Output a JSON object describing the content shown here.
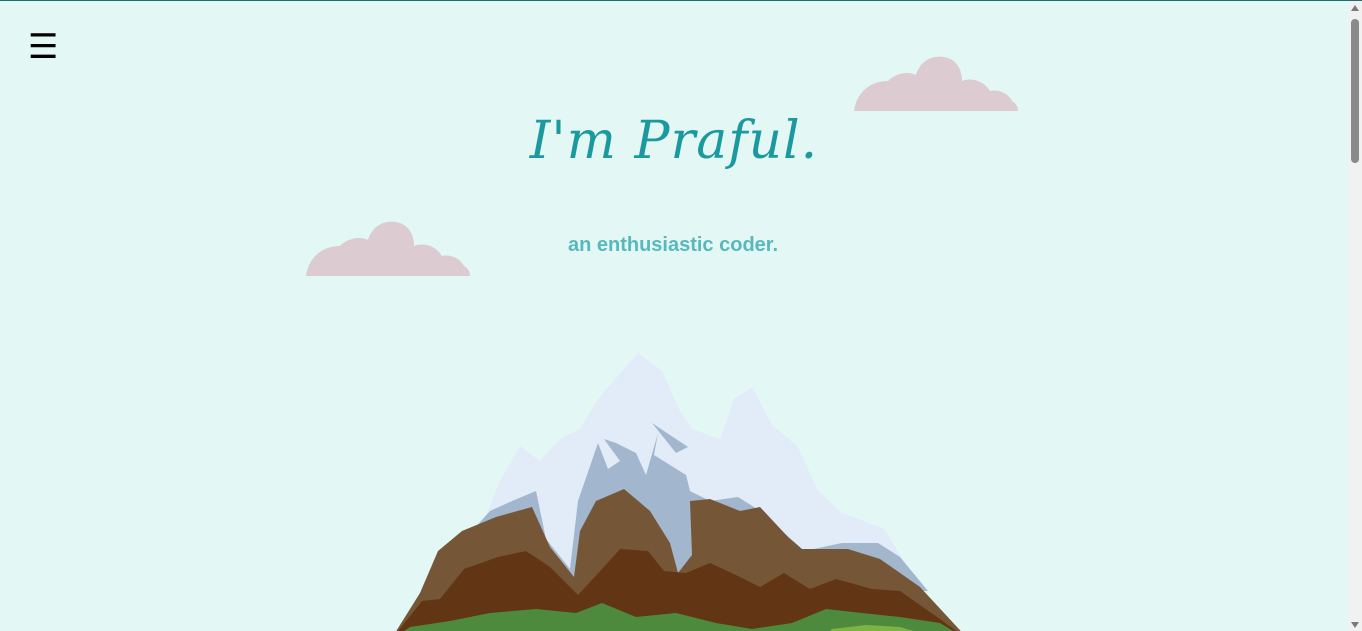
{
  "header": {
    "menu_icon": "☰"
  },
  "hero": {
    "title": "I'm Praful.",
    "subtitle": "an enthusiastic coder."
  },
  "colors": {
    "background": "#e3f7f4",
    "title": "#1a9a9e",
    "subtitle": "#58b9bd",
    "cloud": "#dccbd1"
  },
  "icons": {
    "menu": "hamburger-menu-icon"
  }
}
